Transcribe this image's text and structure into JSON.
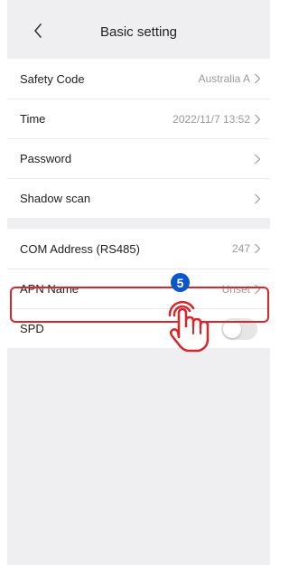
{
  "header": {
    "title": "Basic setting"
  },
  "group1": {
    "rows": [
      {
        "label": "Safety Code",
        "value": "Australia A"
      },
      {
        "label": "Time",
        "value": "2022/11/7 13:52"
      },
      {
        "label": "Password",
        "value": ""
      },
      {
        "label": "Shadow scan",
        "value": ""
      }
    ]
  },
  "group2": {
    "rows": [
      {
        "label": "COM Address (RS485)",
        "value": "247"
      },
      {
        "label": "APN Name",
        "value": "Unset"
      },
      {
        "label": "SPD",
        "toggle": false
      }
    ]
  },
  "annotation": {
    "step_number": "5"
  },
  "colors": {
    "highlight": "#d8262c",
    "badge": "#0b57c7",
    "background": "#efeff2"
  }
}
